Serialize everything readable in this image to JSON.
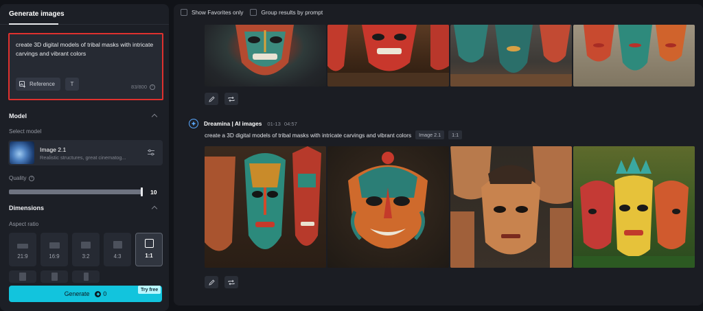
{
  "sidebar": {
    "tab_label": "Generate images",
    "prompt": {
      "text": "create 3D digital models of tribal masks with intricate carvings and vibrant colors",
      "reference_label": "Reference",
      "text_tool_label": "T",
      "char_count": "83/800"
    },
    "model_section": {
      "title": "Model",
      "select_label": "Select model",
      "model_name": "Image 2.1",
      "model_desc": "Realistic structures, great cinematog..."
    },
    "quality": {
      "label": "Quality",
      "value": "10",
      "fraction": 1.0
    },
    "dimensions": {
      "title": "Dimensions",
      "aspect_label": "Aspect ratio",
      "ratios": [
        "21:9",
        "16:9",
        "3:2",
        "4:3",
        "1:1"
      ],
      "selected": "1:1"
    },
    "generate": {
      "label": "Generate",
      "cost": "0",
      "badge": "Try free"
    }
  },
  "main": {
    "filters": {
      "favorites_label": "Show Favorites only",
      "group_label": "Group results by prompt"
    },
    "entry": {
      "source": "Dreamina | AI images",
      "date": "01-13",
      "time": "04:57",
      "prompt": "create a 3D digital models of tribal masks with intricate carvings and vibrant colors",
      "model_tag": "Image 2.1",
      "ratio_tag": "1:1"
    }
  },
  "colors": {
    "accent": "#12c4dd",
    "highlight_border": "#e0312e",
    "brand_ring": "#5aa9ff"
  }
}
